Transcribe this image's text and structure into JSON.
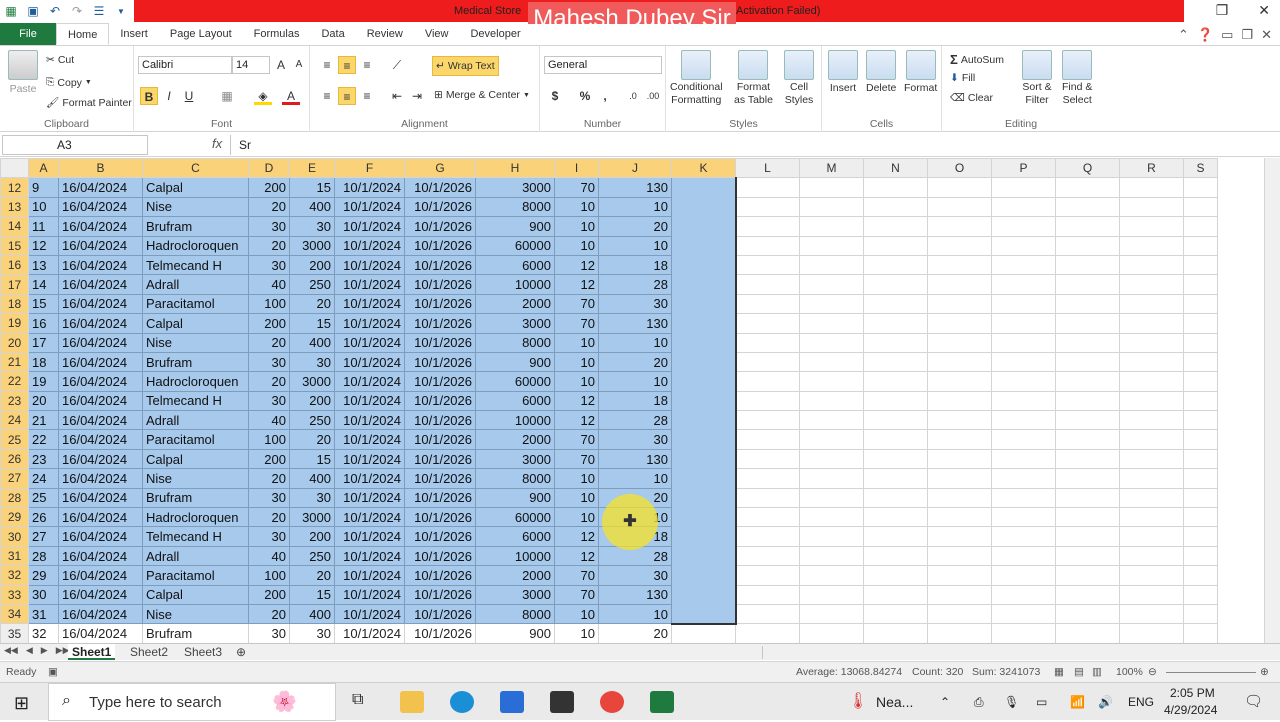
{
  "window": {
    "title": "Medical Store",
    "title_suffix": "Activation Failed)",
    "watermark": "Mahesh Dubey Sir"
  },
  "ribbon_tabs": [
    "File",
    "Home",
    "Insert",
    "Page Layout",
    "Formulas",
    "Data",
    "Review",
    "View",
    "Developer"
  ],
  "ribbon": {
    "clipboard": {
      "paste": "Paste",
      "cut": "Cut",
      "copy": "Copy",
      "format_painter": "Format Painter",
      "label": "Clipboard"
    },
    "font": {
      "name": "Calibri",
      "size": "14",
      "bold": "B",
      "italic": "I",
      "underline": "U",
      "label": "Font"
    },
    "alignment": {
      "wrap": "Wrap Text",
      "merge": "Merge & Center",
      "label": "Alignment"
    },
    "number": {
      "format": "General",
      "currency": "$",
      "percent": "%",
      "comma": ",",
      "label": "Number"
    },
    "styles": {
      "conditional": "Conditional",
      "conditional2": "Formatting",
      "format_table": "Format",
      "format_table2": "as Table",
      "cell_styles": "Cell",
      "cell_styles2": "Styles",
      "label": "Styles"
    },
    "cells": {
      "insert": "Insert",
      "delete": "Delete",
      "format": "Format",
      "label": "Cells"
    },
    "editing": {
      "autosum": "AutoSum",
      "fill": "Fill",
      "clear": "Clear",
      "sort": "Sort &",
      "sort2": "Filter",
      "find": "Find &",
      "find2": "Select",
      "label": "Editing"
    }
  },
  "formula_bar": {
    "name_box": "A3",
    "fx": "fx",
    "content": "Sr"
  },
  "columns": [
    "A",
    "B",
    "C",
    "D",
    "E",
    "F",
    "G",
    "H",
    "I",
    "J",
    "K",
    "L",
    "M",
    "N",
    "O",
    "P",
    "Q",
    "R",
    "S"
  ],
  "rows": [
    {
      "r": "12",
      "a": "9",
      "b": "16/04/2024",
      "c": "Calpal",
      "d": "200",
      "e": "15",
      "f": "10/1/2024",
      "g": "10/1/2026",
      "h": "3000",
      "i": "70",
      "j": "130"
    },
    {
      "r": "13",
      "a": "10",
      "b": "16/04/2024",
      "c": "Nise",
      "d": "20",
      "e": "400",
      "f": "10/1/2024",
      "g": "10/1/2026",
      "h": "8000",
      "i": "10",
      "j": "10"
    },
    {
      "r": "14",
      "a": "11",
      "b": "16/04/2024",
      "c": "Brufram",
      "d": "30",
      "e": "30",
      "f": "10/1/2024",
      "g": "10/1/2026",
      "h": "900",
      "i": "10",
      "j": "20"
    },
    {
      "r": "15",
      "a": "12",
      "b": "16/04/2024",
      "c": "Hadrocloroquen",
      "d": "20",
      "e": "3000",
      "f": "10/1/2024",
      "g": "10/1/2026",
      "h": "60000",
      "i": "10",
      "j": "10"
    },
    {
      "r": "16",
      "a": "13",
      "b": "16/04/2024",
      "c": "Telmecand H",
      "d": "30",
      "e": "200",
      "f": "10/1/2024",
      "g": "10/1/2026",
      "h": "6000",
      "i": "12",
      "j": "18"
    },
    {
      "r": "17",
      "a": "14",
      "b": "16/04/2024",
      "c": "Adrall",
      "d": "40",
      "e": "250",
      "f": "10/1/2024",
      "g": "10/1/2026",
      "h": "10000",
      "i": "12",
      "j": "28"
    },
    {
      "r": "18",
      "a": "15",
      "b": "16/04/2024",
      "c": "Paracitamol",
      "d": "100",
      "e": "20",
      "f": "10/1/2024",
      "g": "10/1/2026",
      "h": "2000",
      "i": "70",
      "j": "30"
    },
    {
      "r": "19",
      "a": "16",
      "b": "16/04/2024",
      "c": "Calpal",
      "d": "200",
      "e": "15",
      "f": "10/1/2024",
      "g": "10/1/2026",
      "h": "3000",
      "i": "70",
      "j": "130"
    },
    {
      "r": "20",
      "a": "17",
      "b": "16/04/2024",
      "c": "Nise",
      "d": "20",
      "e": "400",
      "f": "10/1/2024",
      "g": "10/1/2026",
      "h": "8000",
      "i": "10",
      "j": "10"
    },
    {
      "r": "21",
      "a": "18",
      "b": "16/04/2024",
      "c": "Brufram",
      "d": "30",
      "e": "30",
      "f": "10/1/2024",
      "g": "10/1/2026",
      "h": "900",
      "i": "10",
      "j": "20"
    },
    {
      "r": "22",
      "a": "19",
      "b": "16/04/2024",
      "c": "Hadrocloroquen",
      "d": "20",
      "e": "3000",
      "f": "10/1/2024",
      "g": "10/1/2026",
      "h": "60000",
      "i": "10",
      "j": "10"
    },
    {
      "r": "23",
      "a": "20",
      "b": "16/04/2024",
      "c": "Telmecand H",
      "d": "30",
      "e": "200",
      "f": "10/1/2024",
      "g": "10/1/2026",
      "h": "6000",
      "i": "12",
      "j": "18"
    },
    {
      "r": "24",
      "a": "21",
      "b": "16/04/2024",
      "c": "Adrall",
      "d": "40",
      "e": "250",
      "f": "10/1/2024",
      "g": "10/1/2026",
      "h": "10000",
      "i": "12",
      "j": "28"
    },
    {
      "r": "25",
      "a": "22",
      "b": "16/04/2024",
      "c": "Paracitamol",
      "d": "100",
      "e": "20",
      "f": "10/1/2024",
      "g": "10/1/2026",
      "h": "2000",
      "i": "70",
      "j": "30"
    },
    {
      "r": "26",
      "a": "23",
      "b": "16/04/2024",
      "c": "Calpal",
      "d": "200",
      "e": "15",
      "f": "10/1/2024",
      "g": "10/1/2026",
      "h": "3000",
      "i": "70",
      "j": "130"
    },
    {
      "r": "27",
      "a": "24",
      "b": "16/04/2024",
      "c": "Nise",
      "d": "20",
      "e": "400",
      "f": "10/1/2024",
      "g": "10/1/2026",
      "h": "8000",
      "i": "10",
      "j": "10"
    },
    {
      "r": "28",
      "a": "25",
      "b": "16/04/2024",
      "c": "Brufram",
      "d": "30",
      "e": "30",
      "f": "10/1/2024",
      "g": "10/1/2026",
      "h": "900",
      "i": "10",
      "j": "20"
    },
    {
      "r": "29",
      "a": "26",
      "b": "16/04/2024",
      "c": "Hadrocloroquen",
      "d": "20",
      "e": "3000",
      "f": "10/1/2024",
      "g": "10/1/2026",
      "h": "60000",
      "i": "10",
      "j": "10"
    },
    {
      "r": "30",
      "a": "27",
      "b": "16/04/2024",
      "c": "Telmecand H",
      "d": "30",
      "e": "200",
      "f": "10/1/2024",
      "g": "10/1/2026",
      "h": "6000",
      "i": "12",
      "j": "18"
    },
    {
      "r": "31",
      "a": "28",
      "b": "16/04/2024",
      "c": "Adrall",
      "d": "40",
      "e": "250",
      "f": "10/1/2024",
      "g": "10/1/2026",
      "h": "10000",
      "i": "12",
      "j": "28"
    },
    {
      "r": "32",
      "a": "29",
      "b": "16/04/2024",
      "c": "Paracitamol",
      "d": "100",
      "e": "20",
      "f": "10/1/2024",
      "g": "10/1/2026",
      "h": "2000",
      "i": "70",
      "j": "30"
    },
    {
      "r": "33",
      "a": "30",
      "b": "16/04/2024",
      "c": "Calpal",
      "d": "200",
      "e": "15",
      "f": "10/1/2024",
      "g": "10/1/2026",
      "h": "3000",
      "i": "70",
      "j": "130"
    },
    {
      "r": "34",
      "a": "31",
      "b": "16/04/2024",
      "c": "Nise",
      "d": "20",
      "e": "400",
      "f": "10/1/2024",
      "g": "10/1/2026",
      "h": "8000",
      "i": "10",
      "j": "10"
    },
    {
      "r": "35",
      "a": "32",
      "b": "16/04/2024",
      "c": "Brufram",
      "d": "30",
      "e": "30",
      "f": "10/1/2024",
      "g": "10/1/2026",
      "h": "900",
      "i": "10",
      "j": "20"
    }
  ],
  "selected_through_row": "34",
  "sheets": [
    "Sheet1",
    "Sheet2",
    "Sheet3"
  ],
  "status": {
    "ready": "Ready",
    "average": "Average: 13068.84274",
    "count": "Count: 320",
    "sum": "Sum: 3241073",
    "zoom": "100%"
  },
  "taskbar": {
    "search_placeholder": "Type here to search",
    "weather": "Nea...",
    "lang": "ENG",
    "time": "2:05 PM",
    "date": "4/29/2024"
  },
  "colors": {
    "selection": "#a6c9ec",
    "header_selected": "#f9d27a",
    "excel_green": "#1f7a3f",
    "title_red": "#ee1c1c"
  }
}
